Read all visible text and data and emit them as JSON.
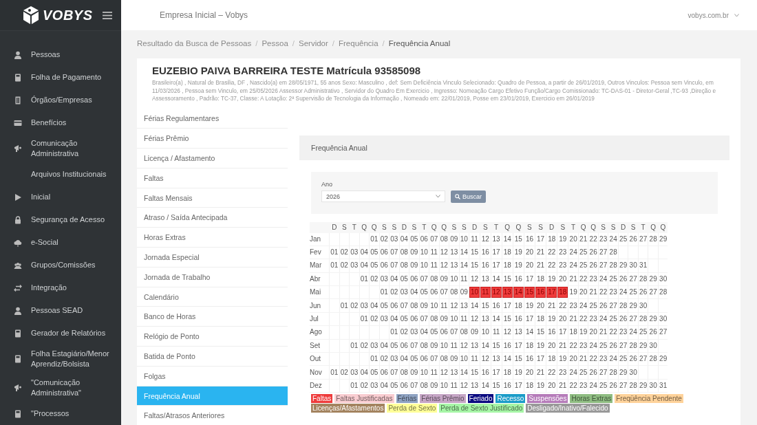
{
  "topbar": {
    "company": "Empresa Inicial – Vobys",
    "domain": "vobys.com.br"
  },
  "sidebar": {
    "brand": "VOBYS",
    "items": [
      {
        "label": "Pessoas",
        "kind": "person"
      },
      {
        "label": "Folha de Pagamento",
        "kind": "calculator"
      },
      {
        "label": "Órgãos/Empresas",
        "kind": "building"
      },
      {
        "label": "Benefícios",
        "kind": "card"
      },
      {
        "label": "Comunicação Administrativa",
        "kind": "megaphone"
      },
      {
        "label": "Arquivos Institucionais",
        "kind": "plain"
      },
      {
        "label": "Inicial",
        "kind": "play"
      },
      {
        "label": "Segurança de Acesso",
        "kind": "lock"
      },
      {
        "label": "e-Social",
        "kind": "cloud"
      },
      {
        "label": "Grupos/Comissões",
        "kind": "group"
      },
      {
        "label": "Integração",
        "kind": "arrows"
      },
      {
        "label": "Pessoas SEAD",
        "kind": "person"
      },
      {
        "label": "Gerador de Relatórios",
        "kind": "calculator"
      },
      {
        "label": "Folha Estagiário/Menor Aprendiz/Bolsista",
        "kind": "calculator"
      },
      {
        "label": "\"Comunicação Administrativa\"",
        "kind": "megaphone"
      },
      {
        "label": "\"Processos",
        "kind": "calculator"
      }
    ]
  },
  "breadcrumb": [
    {
      "label": "Resultado da Busca de Pessoas",
      "kind": "link"
    },
    {
      "label": "/",
      "kind": "separator"
    },
    {
      "label": "Pessoa",
      "kind": "link"
    },
    {
      "label": "/",
      "kind": "separator"
    },
    {
      "label": "Servidor",
      "kind": "link"
    },
    {
      "label": "/",
      "kind": "separator"
    },
    {
      "label": "Frequência",
      "kind": "link"
    },
    {
      "label": "/",
      "kind": "separator"
    },
    {
      "label": "Frequência Anual",
      "kind": "current"
    }
  ],
  "person": {
    "name": "EUZEBIO PAIVA BARREIRA TESTE Matrícula 93585098",
    "details": "Brasileiro(a) , Natural de Brasilia, DF , Nascido(a) em 28/05/1971, 55 anos Sexo: Masculino , def: Sem Deficiência Vinculo Selecionado: Quadro de Pessoa, a partir de 26/01/2019, Outros Vinculos: Pessoa sem Vinculo, em 11/03/2026 , Pessoa sem Vinculo, em 25/05/2026 Assessor Administrativo , Servidor do Quadro Em Exercicio , Ingresso: Nomeação Cargo Efetivo Função/Cargo Comissionado: TC-DAS-01 - Diretor-Geral ,TC-93 ,Direção e Assessoramento , Padrão: TC-37, Classe: A Lotação: 2ª Supervisão de Tecnologia da Informação , Nomeado em: 22/01/2019, Posse em 23/01/2019, Exercicio em 26/01/2019"
  },
  "tabs": [
    {
      "label": "Férias Regulamentares",
      "selected": false
    },
    {
      "label": "Férias Prêmio",
      "selected": false
    },
    {
      "label": "Licença / Afastamento",
      "selected": false
    },
    {
      "label": "Faltas",
      "selected": false
    },
    {
      "label": "Faltas Mensais",
      "selected": false
    },
    {
      "label": "Atraso / Saída Antecipada",
      "selected": false
    },
    {
      "label": "Horas Extras",
      "selected": false
    },
    {
      "label": "Jornada Especial",
      "selected": false
    },
    {
      "label": "Jornada de Trabalho",
      "selected": false
    },
    {
      "label": "Calendário",
      "selected": false
    },
    {
      "label": "Banco de Horas",
      "selected": false
    },
    {
      "label": "Relógio de Ponto",
      "selected": false
    },
    {
      "label": "Batida de Ponto",
      "selected": false
    },
    {
      "label": "Folgas",
      "selected": false
    },
    {
      "label": "Frequência Anual",
      "selected": true
    },
    {
      "label": "Faltas/Atrasos Anteriores",
      "selected": false
    }
  ],
  "panel": {
    "title": "Frequência Anual",
    "year_label": "Ano",
    "year": "2026",
    "search_button": "Buscar",
    "weekdays": [
      "D",
      "S",
      "T",
      "Q",
      "Q",
      "S",
      "S",
      "D",
      "S",
      "T",
      "Q",
      "Q",
      "S",
      "S",
      "D",
      "S",
      "T",
      "Q",
      "Q",
      "S",
      "S",
      "D",
      "S",
      "T",
      "Q",
      "Q",
      "S",
      "S",
      "D",
      "S",
      "T",
      "Q",
      "Q"
    ],
    "months": [
      {
        "name": "Jan",
        "days": [
          "01",
          "02",
          "03",
          "04",
          "05",
          "06",
          "07",
          "08",
          "09",
          "10",
          "11",
          "12",
          "13",
          "14",
          "15",
          "16",
          "17",
          "18",
          "19",
          "20",
          "21",
          "22",
          "23",
          "24",
          "25",
          "26",
          "27",
          "28",
          "29"
        ]
      },
      {
        "name": "Fev",
        "days": [
          "01",
          "02",
          "03",
          "04",
          "05",
          "06",
          "07",
          "08",
          "09",
          "10",
          "11",
          "12",
          "13",
          "14",
          "15",
          "16",
          "17",
          "18",
          "19",
          "20",
          "21",
          "22",
          "23",
          "24",
          "25",
          "26",
          "27",
          "28"
        ]
      },
      {
        "name": "Mar",
        "days": [
          "01",
          "02",
          "03",
          "04",
          "05",
          "06",
          "07",
          "08",
          "09",
          "10",
          "11",
          "12",
          "13",
          "14",
          "15",
          "16",
          "17",
          "18",
          "19",
          "20",
          "21",
          "22",
          "23",
          "24",
          "25",
          "26",
          "27",
          "28",
          "29",
          "30",
          "31"
        ]
      },
      {
        "name": "Abr",
        "days": [
          "01",
          "02",
          "03",
          "04",
          "05",
          "06",
          "07",
          "08",
          "09",
          "10",
          "11",
          "12",
          "13",
          "14",
          "15",
          "16",
          "17",
          "18",
          "19",
          "20",
          "21",
          "22",
          "23",
          "24",
          "25",
          "26",
          "27",
          "28",
          "29",
          "30"
        ]
      },
      {
        "name": "Mai",
        "days": [
          "01",
          "02",
          "03",
          "04",
          "05",
          "06",
          "07",
          "08",
          "09",
          {
            "day": "10",
            "color": "#f03c3c"
          },
          {
            "day": "11",
            "color": "#f03c3c"
          },
          {
            "day": "12",
            "color": "#f03c3c"
          },
          {
            "day": "13",
            "color": "#f03c3c"
          },
          {
            "day": "14",
            "color": "#f03c3c"
          },
          {
            "day": "15",
            "color": "#f03c3c"
          },
          {
            "day": "16",
            "color": "#f03c3c"
          },
          {
            "day": "17",
            "color": "#f03c3c"
          },
          {
            "day": "18",
            "color": "#f03c3c"
          },
          "19",
          "20",
          "21",
          "22",
          "23",
          "24",
          "25",
          "26",
          "27",
          "28"
        ]
      },
      {
        "name": "Jun",
        "days": [
          "01",
          "02",
          "03",
          "04",
          "05",
          "06",
          "07",
          "08",
          "09",
          "10",
          "11",
          "12",
          "13",
          "14",
          "15",
          "16",
          "17",
          "18",
          "19",
          "20",
          "21",
          "22",
          "23",
          "24",
          "25",
          "26",
          "27",
          "28",
          "29",
          "30"
        ]
      },
      {
        "name": "Jul",
        "days": [
          "01",
          "02",
          "03",
          "04",
          "05",
          "06",
          "07",
          "08",
          "09",
          "10",
          "11",
          "12",
          "13",
          "14",
          "15",
          "16",
          "17",
          "18",
          "19",
          "20",
          "21",
          "22",
          "23",
          "24",
          "25",
          "26",
          "27",
          "28",
          "29",
          "30"
        ]
      },
      {
        "name": "Ago",
        "days": [
          "01",
          "02",
          "03",
          "04",
          "05",
          "06",
          "07",
          "08",
          "09",
          "10",
          "11",
          "12",
          "13",
          "14",
          "15",
          "16",
          "17",
          "18",
          "19",
          "20",
          "21",
          "22",
          "23",
          "24",
          "25",
          "26",
          "27"
        ]
      },
      {
        "name": "Set",
        "days": [
          "01",
          "02",
          "03",
          "04",
          "05",
          "06",
          "07",
          "08",
          "09",
          "10",
          "11",
          "12",
          "13",
          "14",
          "15",
          "16",
          "17",
          "18",
          "19",
          "20",
          "21",
          "22",
          "23",
          "24",
          "25",
          "26",
          "27",
          "28",
          "29",
          "30"
        ]
      },
      {
        "name": "Out",
        "days": [
          "01",
          "02",
          "03",
          "04",
          "05",
          "06",
          "07",
          "08",
          "09",
          "10",
          "11",
          "12",
          "13",
          "14",
          "15",
          "16",
          "17",
          "18",
          "19",
          "20",
          "21",
          "22",
          "23",
          "24",
          "25",
          "26",
          "27",
          "28",
          "29"
        ]
      },
      {
        "name": "Nov",
        "days": [
          "01",
          "02",
          "03",
          "04",
          "05",
          "06",
          "07",
          "08",
          "09",
          "10",
          "11",
          "12",
          "13",
          "14",
          "15",
          "16",
          "17",
          "18",
          "19",
          "20",
          "21",
          "22",
          "23",
          "24",
          "25",
          "26",
          "27",
          "28",
          "29",
          "30"
        ]
      },
      {
        "name": "Dez",
        "days": [
          "01",
          "02",
          "03",
          "04",
          "05",
          "06",
          "07",
          "08",
          "09",
          "10",
          "11",
          "12",
          "13",
          "14",
          "15",
          "16",
          "17",
          "18",
          "19",
          "20",
          "21",
          "22",
          "23",
          "24",
          "25",
          "26",
          "27",
          "28",
          "29",
          "30",
          "31"
        ]
      }
    ],
    "legend": [
      {
        "label": "Faltas",
        "color": "#ee3b3b"
      },
      {
        "label": "Faltas Justificadas",
        "color": "#f9cdd1"
      },
      {
        "label": "Férias",
        "color": "#8fa3c2"
      },
      {
        "label": "Férias Prêmio",
        "color": "#c6a6c6"
      },
      {
        "label": "Feriado",
        "color": "#0a0a80"
      },
      {
        "label": "Recesso",
        "color": "#1b9cc8"
      },
      {
        "label": "Suspensões",
        "color": "#b57bb9"
      },
      {
        "label": "Horas Extras",
        "color": "#8fbd82"
      },
      {
        "label": "Freqüência Pendente",
        "color": "#ffd39b"
      },
      {
        "label": "Licenças/Afastamentos",
        "color": "#a3835f"
      },
      {
        "label": "Perda de Sexto",
        "color": "#ffff99"
      },
      {
        "label": "Perda de Sexto Justificado",
        "color": "#a6f5a6"
      },
      {
        "label": "Desligado/Inativo/Falecido",
        "color": "#999999"
      }
    ]
  }
}
